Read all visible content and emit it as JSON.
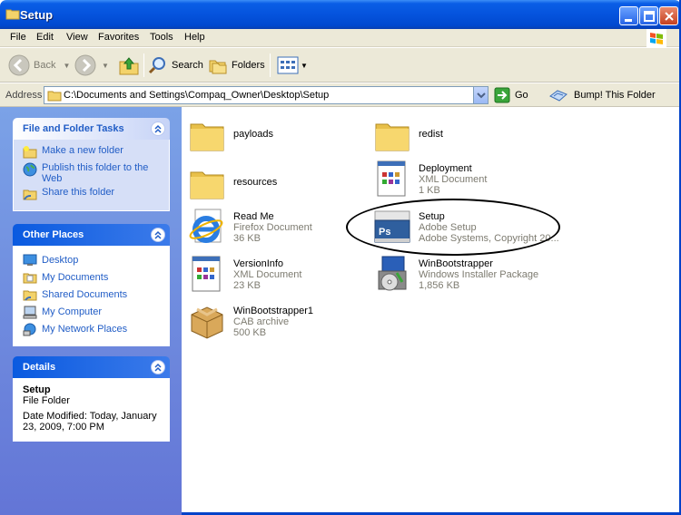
{
  "window": {
    "title": "Setup",
    "colors": {
      "titlebar": "#0553dd",
      "taskpane": "#6375d6",
      "link": "#215dc6"
    }
  },
  "menu": [
    "File",
    "Edit",
    "View",
    "Favorites",
    "Tools",
    "Help"
  ],
  "toolbar": {
    "back_label": "Back",
    "search_label": "Search",
    "folders_label": "Folders"
  },
  "address": {
    "label": "Address",
    "path": "C:\\Documents and Settings\\Compaq_Owner\\Desktop\\Setup",
    "go_label": "Go",
    "bump_label": "Bump! This Folder"
  },
  "tasks": {
    "title": "File and Folder Tasks",
    "items": [
      "Make a new folder",
      "Publish this folder to the Web",
      "Share this folder"
    ]
  },
  "places": {
    "title": "Other Places",
    "items": [
      "Desktop",
      "My Documents",
      "Shared Documents",
      "My Computer",
      "My Network Places"
    ]
  },
  "details": {
    "title": "Details",
    "name": "Setup",
    "type": "File Folder",
    "modified": "Date Modified: Today, January 23, 2009, 7:00 PM"
  },
  "files": [
    {
      "name": "payloads",
      "type": "",
      "size": "",
      "icon": "folder-icon"
    },
    {
      "name": "redist",
      "type": "",
      "size": "",
      "icon": "folder-icon"
    },
    {
      "name": "resources",
      "type": "",
      "size": "",
      "icon": "folder-icon"
    },
    {
      "name": "Deployment",
      "type": "XML Document",
      "size": "1 KB",
      "icon": "xml-document-icon"
    },
    {
      "name": "Read Me",
      "type": "Firefox Document",
      "size": "36 KB",
      "icon": "ie-document-icon"
    },
    {
      "name": "Setup",
      "type": "Adobe Setup",
      "size": "Adobe Systems, Copyright 20...",
      "icon": "photoshop-setup-icon"
    },
    {
      "name": "VersionInfo",
      "type": "XML Document",
      "size": "23 KB",
      "icon": "xml-document-icon"
    },
    {
      "name": "WinBootstrapper",
      "type": "Windows Installer Package",
      "size": "1,856 KB",
      "icon": "installer-package-icon"
    },
    {
      "name": "WinBootstrapper1",
      "type": "CAB archive",
      "size": "500 KB",
      "icon": "cab-archive-icon"
    }
  ]
}
